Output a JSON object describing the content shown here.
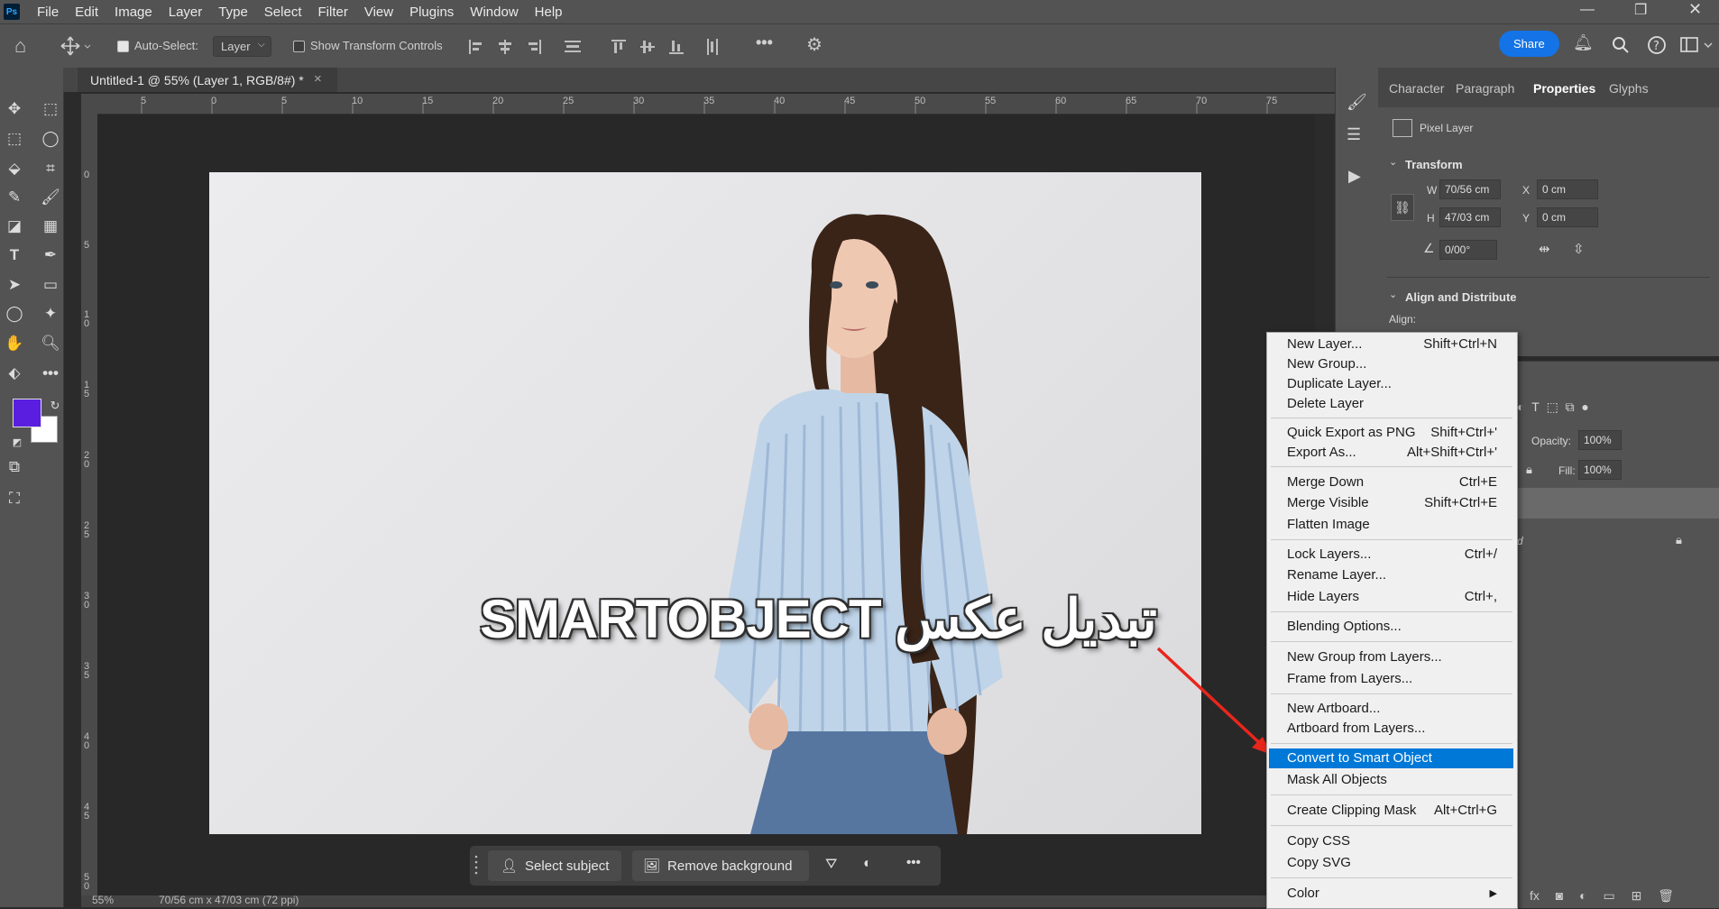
{
  "menubar": {
    "app_icon": "Ps",
    "items": [
      "File",
      "Edit",
      "Image",
      "Layer",
      "Type",
      "Select",
      "Filter",
      "View",
      "Plugins",
      "Window",
      "Help"
    ]
  },
  "options": {
    "auto_select_label": "Auto-Select:",
    "auto_select_value": "Layer",
    "show_transform_label": "Show Transform Controls",
    "more_icon": "•••",
    "share_label": "Share"
  },
  "document": {
    "tab_title": "Untitled-1 @ 55% (Layer 1, RGB/8#) *",
    "close_glyph": "×"
  },
  "ruler": {
    "h_ticks": [
      "5",
      "0",
      "5",
      "10",
      "15",
      "20",
      "25",
      "30",
      "35",
      "40",
      "45",
      "50",
      "55",
      "60",
      "65",
      "70",
      "75"
    ],
    "v_ticks": [
      "0",
      "5",
      "1 0",
      "1 5",
      "2 0",
      "2 5",
      "3 0",
      "3 5",
      "4 0",
      "4 5",
      "5 0"
    ]
  },
  "overlay_title": "SMARTOBJECT تبدیل عکس",
  "contextual_bar": {
    "select_subject": "Select subject",
    "remove_background": "Remove background",
    "more": "•••"
  },
  "status": {
    "zoom": "55%",
    "doc_size": "70/56 cm x 47/03 cm (72 ppi)"
  },
  "properties": {
    "tabs": [
      "Character",
      "Paragraph",
      "Properties",
      "Glyphs"
    ],
    "active_tab": "Properties",
    "layer_kind": "Pixel Layer",
    "transform_heading": "Transform",
    "w_label": "W",
    "w_value": "70/56 cm",
    "h_label": "H",
    "h_value": "47/03 cm",
    "x_label": "X",
    "x_value": "0 cm",
    "y_label": "Y",
    "y_value": "0 cm",
    "angle_value": "0/00°",
    "align_heading": "Align and Distribute",
    "align_label": "Align:"
  },
  "layers": {
    "opacity_label": "Opacity:",
    "opacity_value": "100%",
    "fill_label": "Fill:",
    "fill_value": "100%",
    "partial_name": "d"
  },
  "context_menu": {
    "items": [
      {
        "label": "New Layer...",
        "shortcut": "Shift+Ctrl+N"
      },
      {
        "label": "New Group...",
        "shortcut": ""
      },
      {
        "label": "Duplicate Layer...",
        "shortcut": ""
      },
      {
        "label": "Delete Layer",
        "shortcut": ""
      },
      {
        "label": "Quick Export as PNG",
        "shortcut": "Shift+Ctrl+'"
      },
      {
        "label": "Export As...",
        "shortcut": "Alt+Shift+Ctrl+'"
      },
      {
        "label": "Merge Down",
        "shortcut": "Ctrl+E"
      },
      {
        "label": "Merge Visible",
        "shortcut": "Shift+Ctrl+E"
      },
      {
        "label": "Flatten Image",
        "shortcut": ""
      },
      {
        "label": "Lock Layers...",
        "shortcut": "Ctrl+/"
      },
      {
        "label": "Rename Layer...",
        "shortcut": ""
      },
      {
        "label": "Hide Layers",
        "shortcut": "Ctrl+,"
      },
      {
        "label": "Blending Options...",
        "shortcut": ""
      },
      {
        "label": "New Group from Layers...",
        "shortcut": ""
      },
      {
        "label": "Frame from Layers...",
        "shortcut": ""
      },
      {
        "label": "New Artboard...",
        "shortcut": ""
      },
      {
        "label": "Artboard from Layers...",
        "shortcut": ""
      },
      {
        "label": "Convert to Smart Object",
        "shortcut": ""
      },
      {
        "label": "Mask All Objects",
        "shortcut": ""
      },
      {
        "label": "Create Clipping Mask",
        "shortcut": "Alt+Ctrl+G"
      },
      {
        "label": "Copy CSS",
        "shortcut": ""
      },
      {
        "label": "Copy SVG",
        "shortcut": ""
      },
      {
        "label": "Color",
        "shortcut": ""
      }
    ],
    "highlighted": "Convert to Smart Object"
  },
  "colors": {
    "foreground": "#5a1ee0",
    "background": "#ffffff",
    "highlight": "#0078d7",
    "arrow": "#e8261c"
  }
}
